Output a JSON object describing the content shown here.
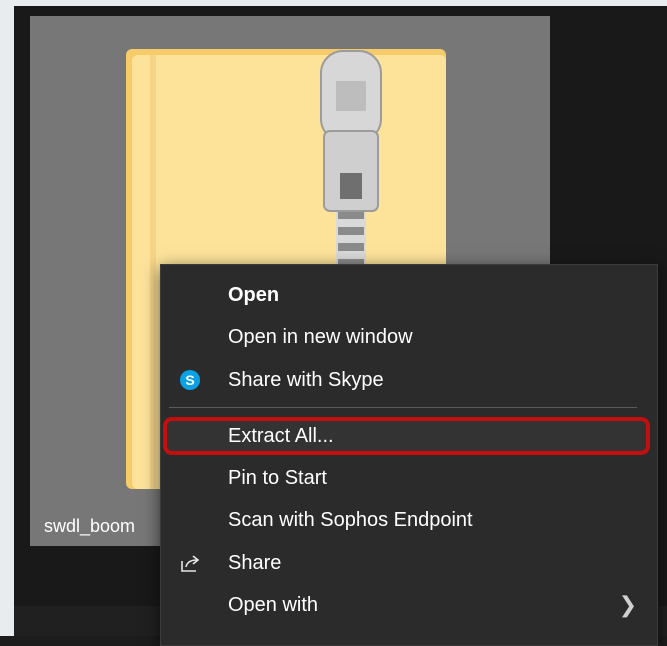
{
  "file": {
    "name_label": "swdl_boom"
  },
  "context_menu": {
    "items": [
      {
        "label": "Open",
        "icon": null
      },
      {
        "label": "Open in new window",
        "icon": null
      },
      {
        "label": "Share with Skype",
        "icon": "skype-icon"
      },
      {
        "label": "Extract All...",
        "icon": null
      },
      {
        "label": "Pin to Start",
        "icon": null
      },
      {
        "label": "Scan with Sophos Endpoint",
        "icon": null
      },
      {
        "label": "Share",
        "icon": "share-icon"
      },
      {
        "label": "Open with",
        "icon": null,
        "submenu": "chevron-right-icon"
      }
    ]
  },
  "colors": {
    "highlight_border": "#c40f0f",
    "skype_blue": "#0aa1e6",
    "folder_yellow": "#ffe08a"
  }
}
